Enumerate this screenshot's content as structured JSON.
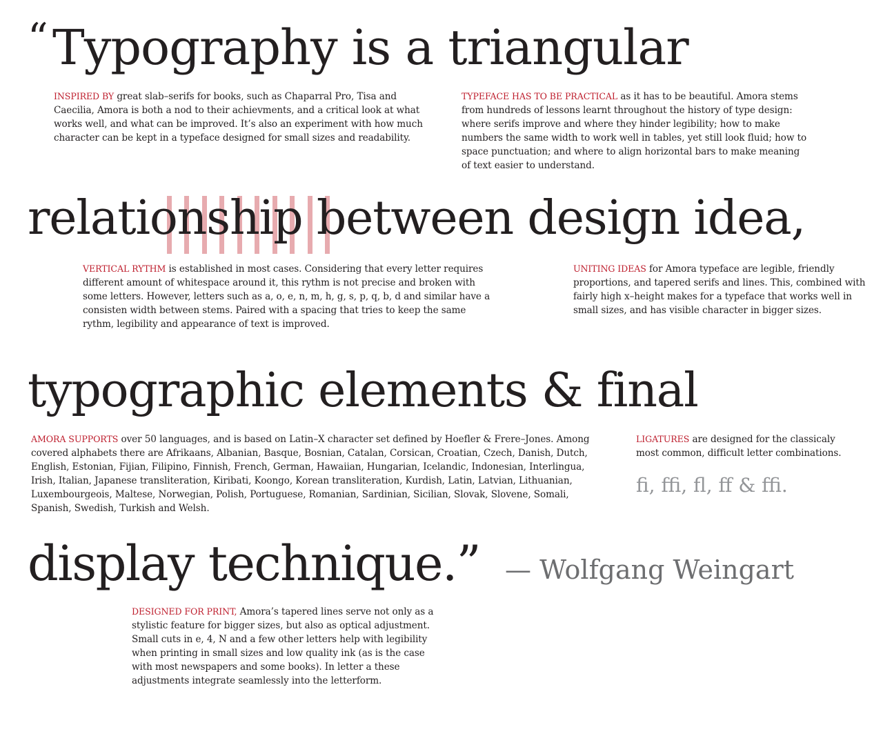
{
  "headline": {
    "open_quote": "“",
    "line1": "Typography is a triangular",
    "line2": "relationship between design idea,",
    "line3": "typographic elements & final",
    "line4": "display technique.”",
    "attribution": "— Wolfgang Weingart"
  },
  "blocks": {
    "inspired": {
      "lead": "INSPIRED BY",
      "text": " great slab–serifs for books, such as Chaparral Pro, Tisa and Caecilia, Amora is both a nod to their achievments, and a critical look at what works well, and what can be improved. It’s also an experiment with how much character can be kept in a typeface designed for small sizes and readability."
    },
    "practical": {
      "lead": "TYPEFACE HAS TO BE PRACTICAL",
      "text": " as it has to be beautiful. Amora stems from hundreds of lessons learnt throughout the history of type design: where serifs improve and where they hinder legibility; how to make numbers the same width to work well in tables, yet still look fluid; how to space punctuation; and where to align horizontal bars to make meaning of text easier to understand."
    },
    "rhythm": {
      "lead": "VERTICAL RYTHM",
      "text": " is established in most cases. Considering that every letter requires different amount of whitespace around it, this rythm is not precise and broken with some letters. However, letters such as a, o, e, n, m, h, g, s, p, q, b, d and similar have a consisten width between stems. Paired with a spacing that tries to keep the same rythm, legibility and appearance of text is improved."
    },
    "uniting": {
      "lead": "UNITING IDEAS",
      "text": " for Amora typeface are legible, friendly proportions, and tapered serifs and lines. This, combined with fairly high x–height makes for a typeface that works well in small sizes, and has visible character in bigger sizes."
    },
    "supports": {
      "lead": "AMORA SUPPORTS",
      "text": " over 50 languages, and is based on Latin–X character set defined by Hoefler & Frere–Jones. Among covered alphabets there are Afrikaans, Albanian, Basque, Bosnian, Catalan, Corsican, Croatian, Czech, Danish, Dutch, English, Estonian, Fijian, Filipino, Finnish, French, German, Hawaiian, Hungarian, Icelandic, Indonesian, Interlingua, Irish, Italian, Japanese transliteration, Kiribati, Koongo, Korean transliteration, Kurdish, Latin, Latvian, Lithuanian, Luxembourgeois, Maltese, Norwegian, Polish, Portuguese, Romanian, Sardinian, Sicilian, Slovak, Slovene, Somali, Spanish, Swedish, Turkish and Welsh."
    },
    "ligatures": {
      "lead": "LIGATURES",
      "text": " are designed for the classicaly most common, difficult letter combinations.",
      "sample": "ﬁ, ﬃ, ﬂ, ﬀ & ﬃ."
    },
    "print": {
      "lead": "DESIGNED FOR PRINT,",
      "text": " Amora’s tapered lines serve not only as a stylistic feature for bigger sizes, but also as optical adjustment. Small cuts in e, 4, N and a few other letters help with legibility when printing in small sizes and low quality ink (as is the case with most newspapers and some books). In letter a these adjustments integrate seamlessly into the letterform."
    }
  },
  "colors": {
    "text": "#231f20",
    "accent_red": "#be1e2d",
    "rhythm_stripe": "#e39ca1",
    "attribution_gray": "#6d6e70",
    "ligature_gray": "#939598",
    "background": "#ffffff"
  }
}
